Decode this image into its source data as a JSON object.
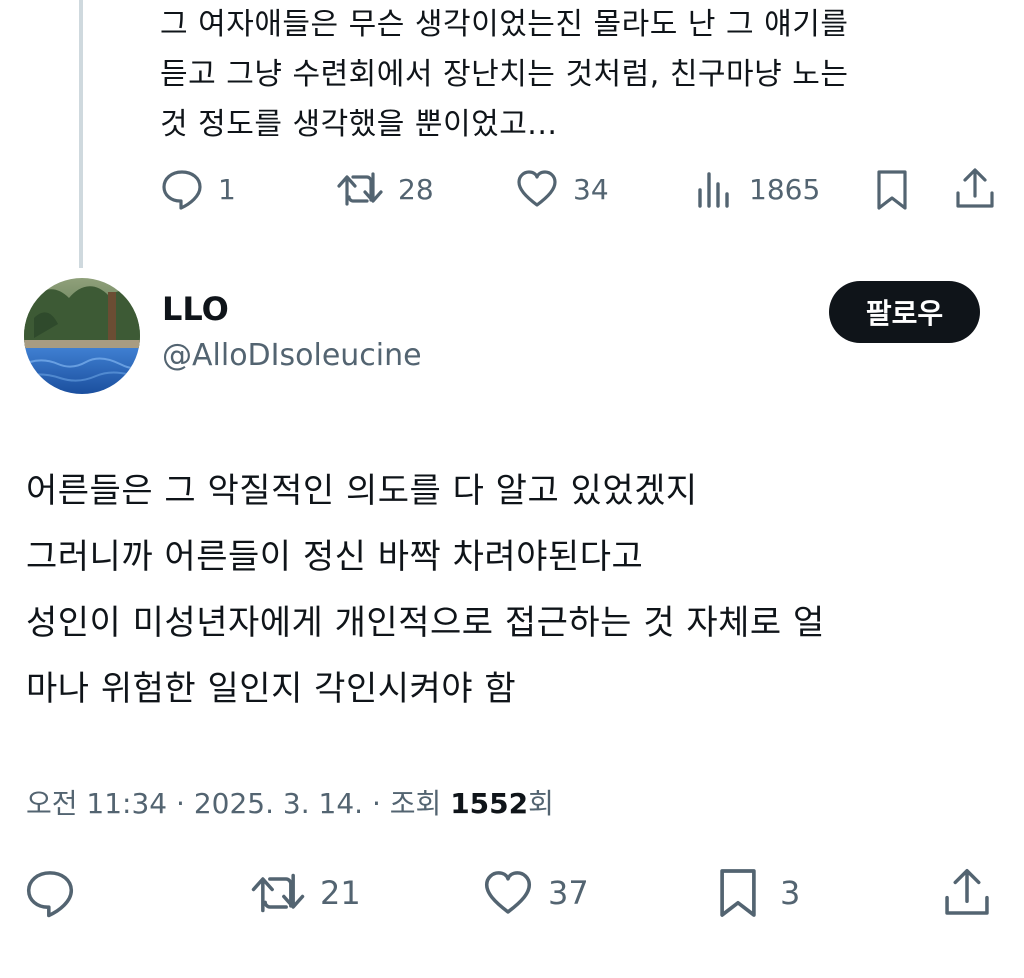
{
  "previous_post": {
    "lines": [
      "그 여자애들은 무슨 생각이었는진 몰라도 난 그 얘기를",
      "듣고 그냥 수련회에서 장난치는 것처럼, 친구마냥 노는",
      "것 정도를 생각했을 뿐이었고..."
    ],
    "actions": {
      "reply_count": "1",
      "repost_count": "28",
      "like_count": "34",
      "views_count": "1865"
    }
  },
  "post": {
    "author": {
      "display_name": "LLO",
      "handle": "@AlloDIsoleucine"
    },
    "follow_label": "팔로우",
    "lines": [
      "어른들은 그 악질적인 의도를 다 알고 있었겠지",
      "그러니까 어른들이 정신 바짝 차려야된다고",
      "성인이 미성년자에게 개인적으로 접근하는 것 자체로 얼",
      "마나 위험한 일인지 각인시켜야 함"
    ],
    "meta": {
      "time": "오전 11:34",
      "separator": "·",
      "date": "2025. 3. 14.",
      "views_label": "조회",
      "views_count": "1552",
      "views_suffix": "회"
    },
    "actions": {
      "repost_count": "21",
      "like_count": "37",
      "bookmark_count": "3"
    }
  },
  "icons": {
    "reply": "speech-bubble-icon",
    "repost": "repost-arrows-icon",
    "like": "heart-icon",
    "views": "bar-chart-icon",
    "bookmark": "bookmark-icon",
    "share": "share-upload-icon"
  },
  "colors": {
    "text": "#0f1419",
    "secondary": "#536471",
    "thread_line": "#cfd9de",
    "follow_button": "#0f1419"
  }
}
